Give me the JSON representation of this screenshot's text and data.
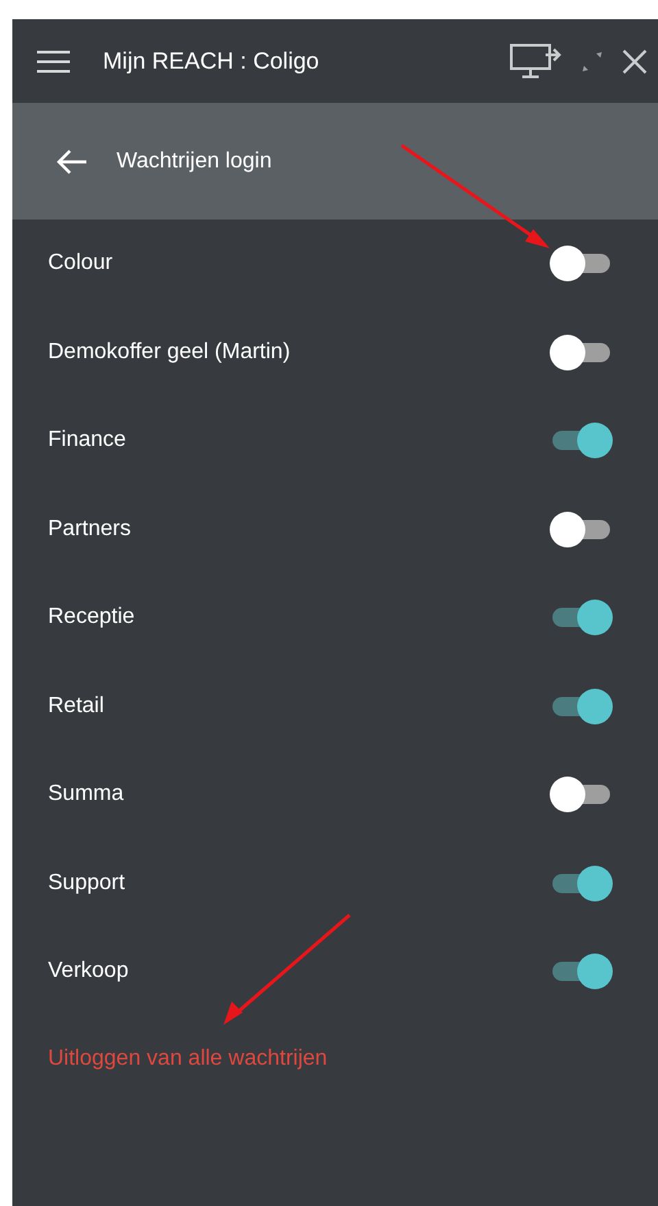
{
  "window": {
    "title": "Mijn REACH : Coligo"
  },
  "subheader": {
    "title": "Wachtrijen login"
  },
  "queues": [
    {
      "name": "Colour",
      "on": false
    },
    {
      "name": "Demokoffer geel (Martin)",
      "on": false
    },
    {
      "name": "Finance",
      "on": true
    },
    {
      "name": "Partners",
      "on": false
    },
    {
      "name": "Receptie",
      "on": true
    },
    {
      "name": "Retail",
      "on": true
    },
    {
      "name": "Summa",
      "on": false
    },
    {
      "name": "Support",
      "on": true
    },
    {
      "name": "Verkoop",
      "on": true
    }
  ],
  "logout_link": "Uitloggen van alle wachtrijen"
}
